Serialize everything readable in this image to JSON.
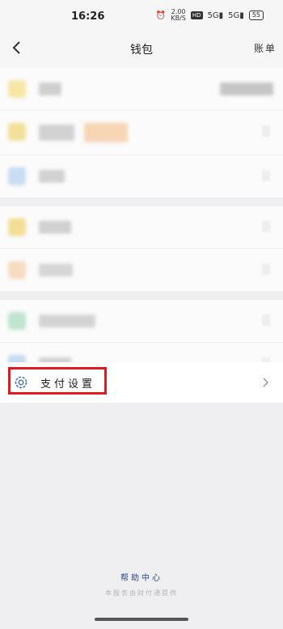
{
  "status": {
    "time": "16:26",
    "net_speed_top": "2.00",
    "net_speed_bottom": "KB/S",
    "hd1": "HD",
    "sig1": "5G",
    "sig2": "5G",
    "battery": "55"
  },
  "nav": {
    "title": "钱包",
    "right_link": "账单",
    "back_icon": "chevron-left-icon"
  },
  "settings": {
    "label": "支付设置",
    "icon": "gear-icon",
    "highlight_color": "#e01a22"
  },
  "footer": {
    "help_link": "帮助中心",
    "note": "本服务由财付通提供"
  }
}
